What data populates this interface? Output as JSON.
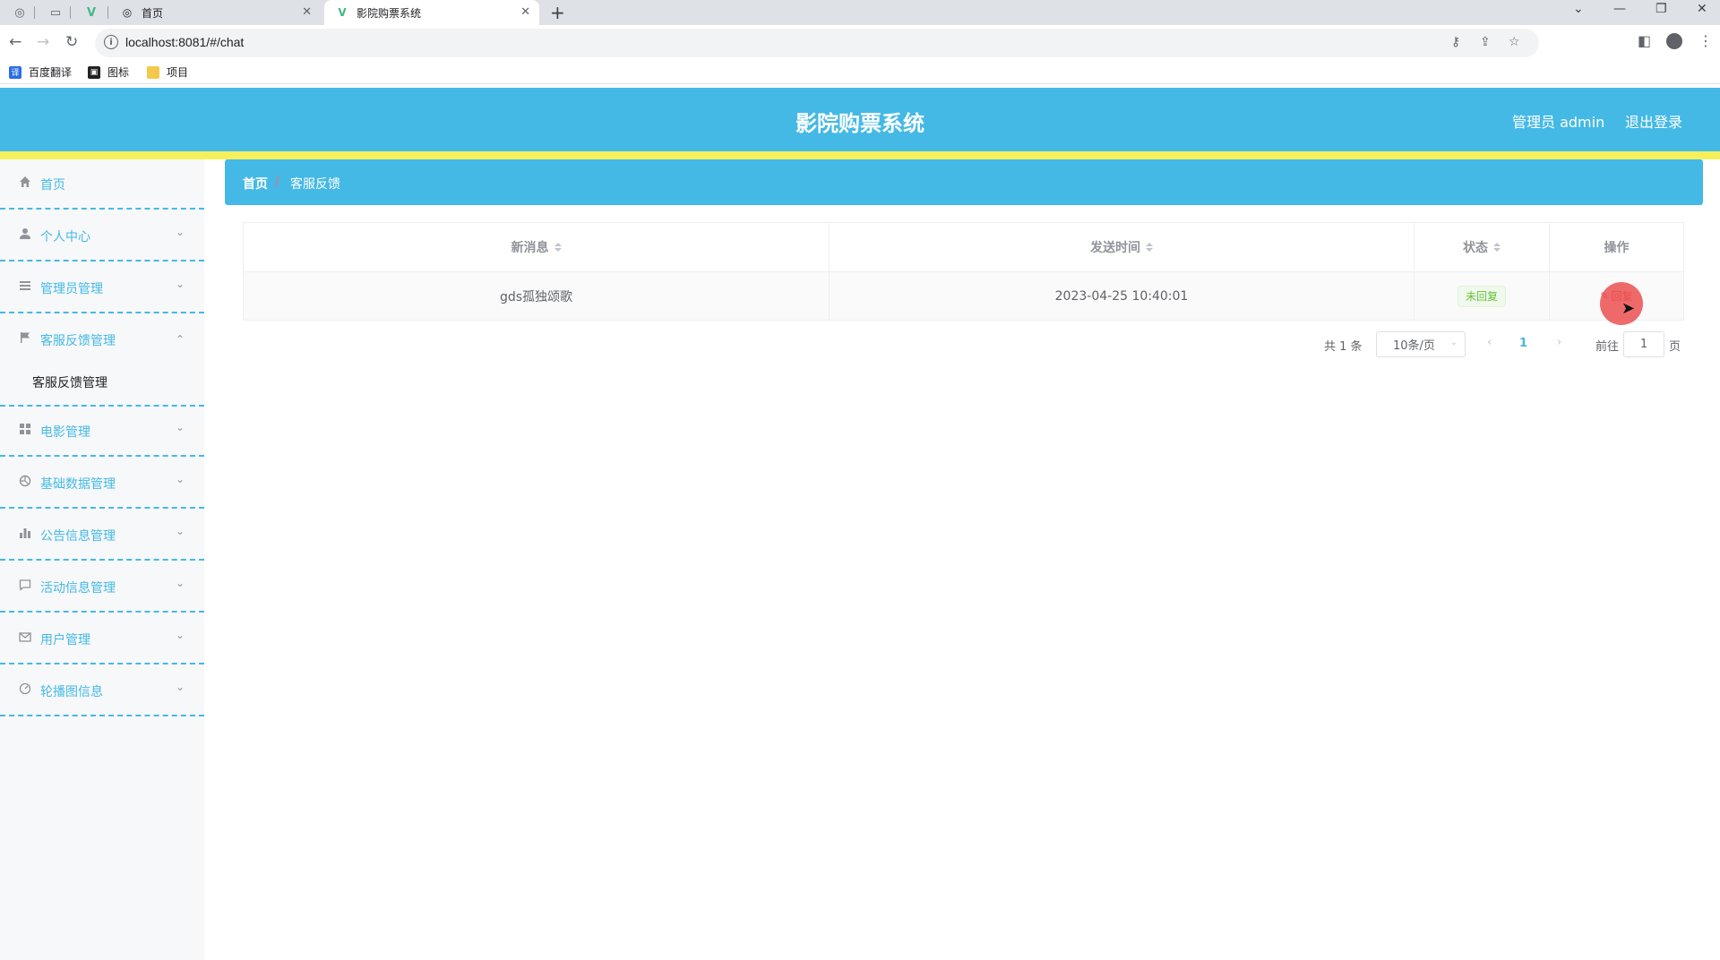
{
  "browser": {
    "tabs": [
      {
        "title": "首页"
      },
      {
        "title": "影院购票系统"
      }
    ],
    "url": "localhost:8081/#/chat",
    "bookmarks": [
      {
        "label": "百度翻译"
      },
      {
        "label": "图标"
      },
      {
        "label": "项目"
      }
    ]
  },
  "header": {
    "title": "影院购票系统",
    "user_label": "管理员 admin",
    "logout_label": "退出登录"
  },
  "sidebar": {
    "items": [
      {
        "label": "首页",
        "icon": "home-icon"
      },
      {
        "label": "个人中心",
        "icon": "user-icon"
      },
      {
        "label": "管理员管理",
        "icon": "menu-icon"
      },
      {
        "label": "客服反馈管理",
        "icon": "flag-icon",
        "expanded": true
      },
      {
        "label": "电影管理",
        "icon": "grid-icon"
      },
      {
        "label": "基础数据管理",
        "icon": "aperture-icon"
      },
      {
        "label": "公告信息管理",
        "icon": "bar-chart-icon"
      },
      {
        "label": "活动信息管理",
        "icon": "chat-icon"
      },
      {
        "label": "用户管理",
        "icon": "mail-icon"
      },
      {
        "label": "轮播图信息",
        "icon": "gauge-icon"
      }
    ],
    "sub_item": {
      "label": "客服反馈管理"
    }
  },
  "breadcrumb": {
    "home": "首页",
    "sep": "/",
    "current": "客服反馈"
  },
  "table": {
    "columns": [
      "新消息",
      "发送时间",
      "状态",
      "操作"
    ],
    "rows": [
      {
        "message": "gds孤独颂歌",
        "time": "2023-04-25 10:40:01",
        "status": "未回复",
        "action": "回复"
      }
    ]
  },
  "pagination": {
    "total_text": "共 1 条",
    "page_size": "10条/页",
    "current_page": "1",
    "goto_prefix": "前往",
    "goto_value": "1",
    "goto_suffix": "页"
  },
  "colors": {
    "header_bg": "#45b9e5",
    "accent_bar": "#f5f05c",
    "status_green": "#67c23a",
    "danger_red": "#f56c6c"
  }
}
